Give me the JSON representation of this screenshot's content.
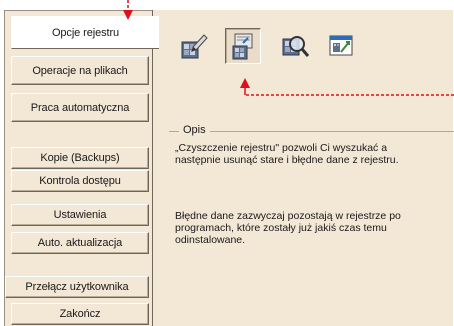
{
  "sidebar": {
    "items": [
      {
        "label": "Opcje rejestru"
      },
      {
        "label": "Operacje na plikach"
      },
      {
        "label": "Praca automatyczna"
      },
      {
        "label": "Kopie (Backups)"
      },
      {
        "label": "Kontrola dostępu"
      },
      {
        "label": "Ustawienia"
      },
      {
        "label": "Auto. aktualizacja"
      },
      {
        "label": "Przełącz użytkownika"
      },
      {
        "label": "Zakończ"
      }
    ]
  },
  "toolbar": {
    "icons": [
      {
        "name": "registry-edit-icon"
      },
      {
        "name": "registry-clean-icon"
      },
      {
        "name": "registry-search-icon"
      },
      {
        "name": "registry-optimize-icon"
      }
    ]
  },
  "description": {
    "title": "Opis",
    "paragraph1": "„Czyszczenie rejestru\" pozwoli Ci wyszukać a następnie usunąć stare i błędne dane z rejestru.",
    "paragraph2": "Błędne dane zazwyczaj pozostają w rejestrze po programach, które zostały już jakiś czas temu odinstalowane."
  },
  "colors": {
    "annotation": "#e0101a",
    "panel": "#f3e7d6"
  }
}
